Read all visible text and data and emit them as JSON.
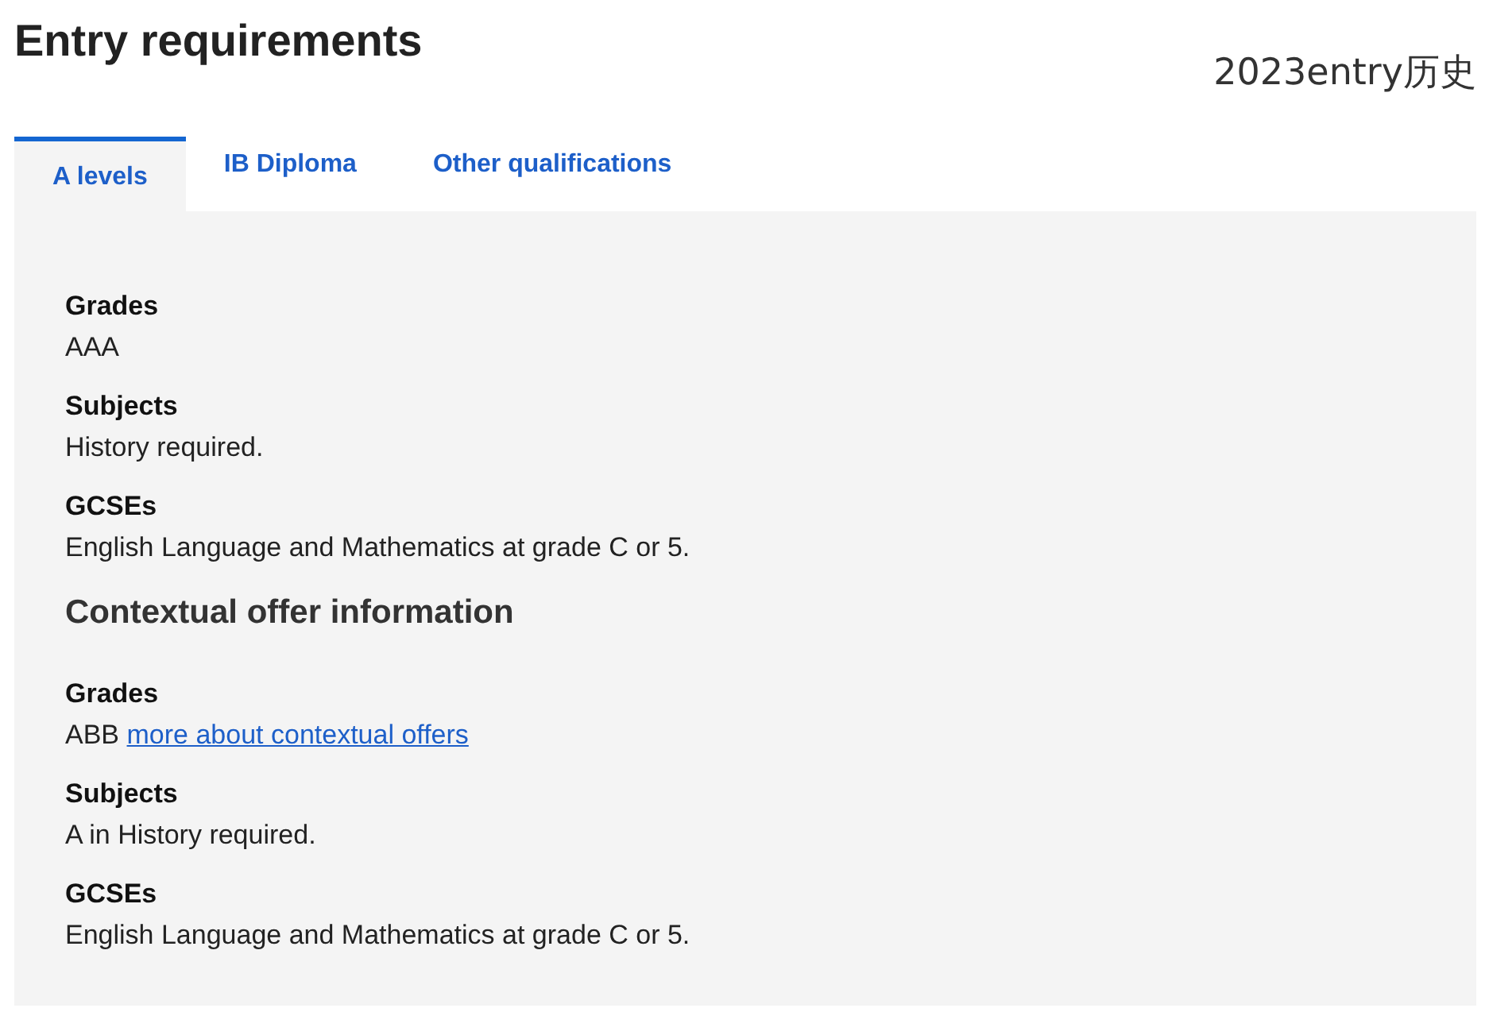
{
  "title": "Entry requirements",
  "caption": "2023entry历史",
  "tabs": [
    {
      "label": "A levels",
      "selected": true
    },
    {
      "label": "IB Diploma",
      "selected": false
    },
    {
      "label": "Other qualifications",
      "selected": false
    }
  ],
  "sections": [
    {
      "items": [
        {
          "heading": "Grades",
          "text": "AAA"
        },
        {
          "heading": "Subjects",
          "text": "History required."
        },
        {
          "heading": "GCSEs",
          "text": "English Language and Mathematics at grade C or 5."
        }
      ]
    },
    {
      "title": "Contextual offer information",
      "items": [
        {
          "heading": "Grades",
          "text": "ABB",
          "link": "more about contextual offers"
        },
        {
          "heading": "Subjects",
          "text": "A in History required."
        },
        {
          "heading": "GCSEs",
          "text": "English Language and Mathematics at grade C or 5."
        }
      ]
    }
  ]
}
